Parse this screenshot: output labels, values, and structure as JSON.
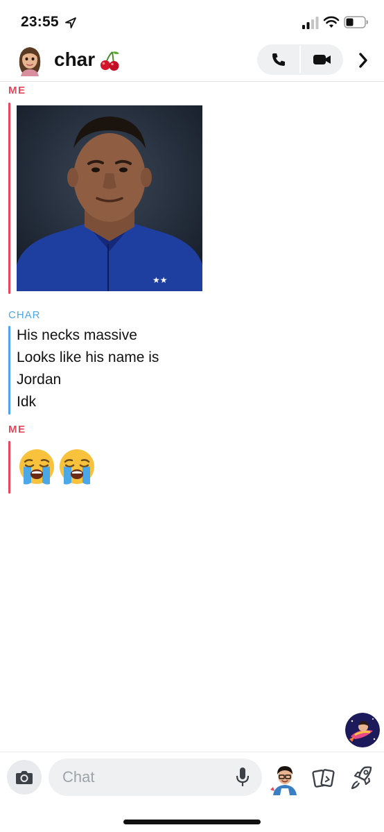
{
  "status_bar": {
    "time": "23:55"
  },
  "header": {
    "name": "char",
    "name_emoji": "🍒"
  },
  "messages": [
    {
      "sender": "ME",
      "type": "image",
      "description_icon": "photo"
    },
    {
      "sender": "CHAR",
      "type": "text",
      "lines": [
        "His necks massive",
        "Looks like his name is",
        "Jordan",
        "Idk"
      ]
    },
    {
      "sender": "ME",
      "type": "emoji",
      "emojis": [
        "😭",
        "😭"
      ]
    }
  ],
  "composer": {
    "placeholder": "Chat"
  },
  "colors": {
    "me": "#e4485a",
    "char": "#4ca6ea",
    "input_bg": "#eef0f2"
  }
}
